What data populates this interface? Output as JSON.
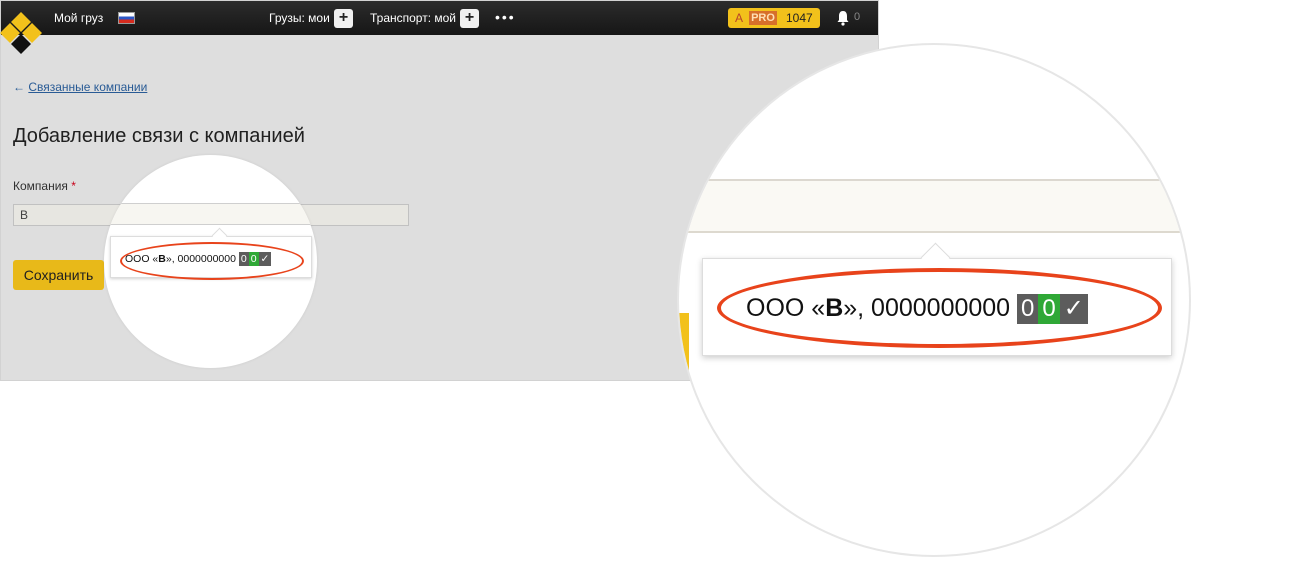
{
  "header": {
    "my_cargo": "Мой груз",
    "cargo_menu": "Грузы: мои",
    "transport_menu": "Транспорт: мой",
    "more": "•••",
    "pro_prefix": "A",
    "pro_label": "PRO",
    "pro_count": "1047",
    "notifications_count": "0"
  },
  "back_link": {
    "arrow": "←",
    "label": "Связанные компании"
  },
  "page": {
    "title": "Добавление связи с компанией"
  },
  "form": {
    "company_label": "Компания",
    "required_mark": "*",
    "company_value": "В",
    "save_label": "Сохранить"
  },
  "suggestion": {
    "prefix": "ООО «",
    "match": "В",
    "suffix": "», 0000000000",
    "badge_1": "0",
    "badge_2": "0",
    "badge_check": "✓"
  },
  "colors": {
    "accent_yellow": "#f2c11b",
    "highlight_red": "#e8431b",
    "badge_green": "#2fa836",
    "badge_dark": "#5c5c5c"
  },
  "icons": {
    "logo": "logo-icon",
    "flag": "russia-flag-icon",
    "plus": "plus-icon",
    "bell": "bell-icon",
    "check": "check-icon"
  }
}
